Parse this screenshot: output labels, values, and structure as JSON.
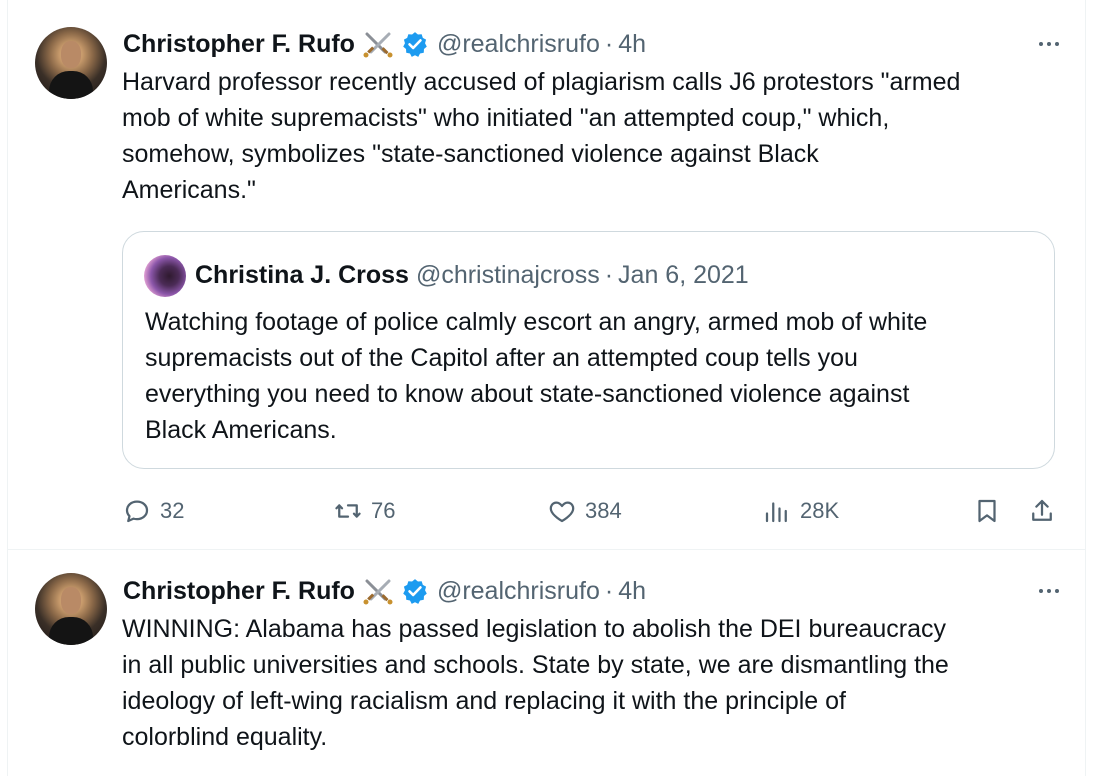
{
  "tweets": [
    {
      "author_name": "Christopher F. Rufo",
      "handle": "@realchrisrufo",
      "separator": "·",
      "time": "4h",
      "text": "Harvard professor recently accused of plagiarism calls J6 protestors \"armed\nmob of white supremacists\" who initiated \"an attempted coup,\" which,\nsomehow, symbolizes \"state-sanctioned violence against Black\nAmericans.\"",
      "quote": {
        "author_name": "Christina J. Cross",
        "handle": "@christinajcross",
        "separator": "·",
        "date": "Jan 6, 2021",
        "text": "Watching footage of police calmly escort an angry, armed mob of white\nsupremacists out of the Capitol after an attempted coup tells you\neverything you need to know about state-sanctioned violence against\nBlack Americans."
      },
      "actions": {
        "replies": "32",
        "retweets": "76",
        "likes": "384",
        "views": "28K"
      }
    },
    {
      "author_name": "Christopher F. Rufo",
      "handle": "@realchrisrufo",
      "separator": "·",
      "time": "4h",
      "text": "WINNING: Alabama has passed legislation to abolish the DEI bureaucracy\nin all public universities and schools. State by state, we are dismantling the\nideology of left-wing racialism and replacing it with the principle of\ncolorblind equality."
    }
  ],
  "icons": {
    "verified": "verified-badge-icon",
    "emoji": "crossed-swords-icon",
    "more": "more-icon",
    "reply": "reply-icon",
    "retweet": "retweet-icon",
    "like": "heart-icon",
    "views": "views-icon",
    "bookmark": "bookmark-icon",
    "share": "share-icon"
  },
  "colors": {
    "text": "#0f1419",
    "secondary": "#536471",
    "verified": "#1d9bf0",
    "border": "#eff3f4",
    "quote_border": "#cfd9de"
  }
}
